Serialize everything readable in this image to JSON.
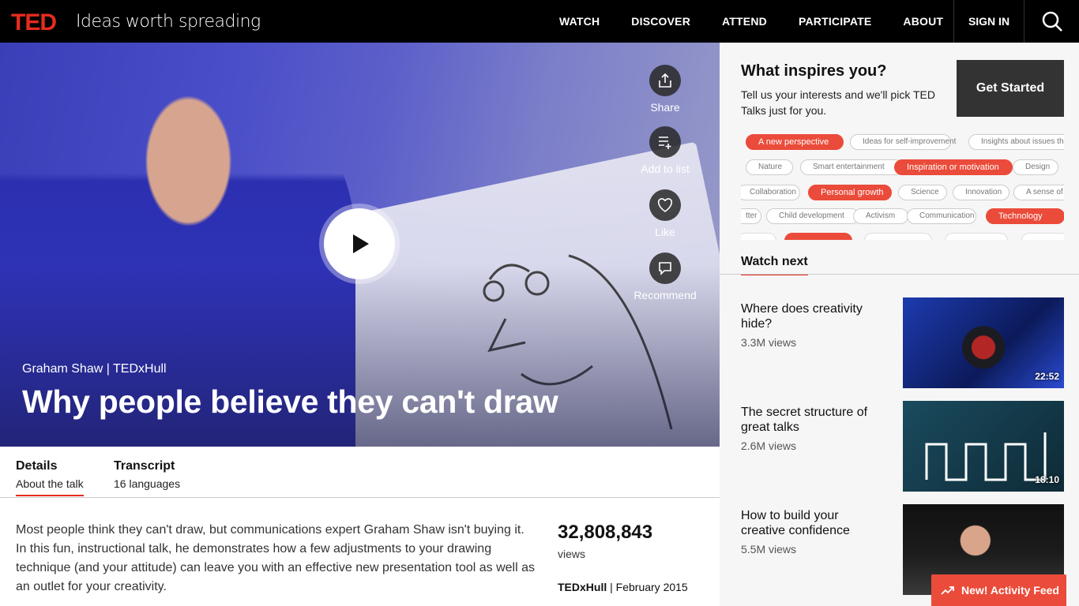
{
  "header": {
    "logo": "TED",
    "tagline": "Ideas worth spreading",
    "nav": [
      "WATCH",
      "DISCOVER",
      "ATTEND",
      "PARTICIPATE",
      "ABOUT"
    ],
    "sign_in": "SIGN IN",
    "search_icon": "search-icon"
  },
  "hero": {
    "speaker": "Graham Shaw | TEDxHull",
    "title": "Why people believe they can't draw",
    "actions": {
      "share": "Share",
      "add_to_list": "Add to list",
      "like": "Like",
      "recommend": "Recommend"
    }
  },
  "tabs": [
    {
      "label": "Details",
      "sub": "About the talk"
    },
    {
      "label": "Transcript",
      "sub": "16 languages"
    }
  ],
  "details": {
    "description": "Most people think they can't draw, but communications expert Graham Shaw isn't buying it. In this fun, instructional talk, he demonstrates how a few adjustments to your drawing technique (and your attitude) can leave you with an effective new presentation tool as well as an outlet for your creativity.",
    "views_count": "32,808,843",
    "views_label": "views",
    "event": "TEDxHull",
    "date": "February 2015"
  },
  "inspire": {
    "title": "What inspires you?",
    "subtitle": "Tell us your interests and we'll pick TED Talks just for you.",
    "cta": "Get Started",
    "rows": [
      [
        {
          "label": "A new perspective",
          "selected": true
        },
        {
          "label": "Ideas for self-improvement",
          "selected": false
        },
        {
          "label": "Insights about issues tha",
          "selected": false
        }
      ],
      [
        {
          "label": "Nature",
          "selected": false
        },
        {
          "label": "Smart entertainment",
          "selected": false
        },
        {
          "label": "Inspiration or motivation",
          "selected": true
        },
        {
          "label": "Design",
          "selected": false
        }
      ],
      [
        {
          "label": "Collaboration",
          "selected": false
        },
        {
          "label": "Personal growth",
          "selected": true
        },
        {
          "label": "Science",
          "selected": false
        },
        {
          "label": "Innovation",
          "selected": false
        },
        {
          "label": "A sense of h",
          "selected": false
        }
      ],
      [
        {
          "label": "tter",
          "selected": false
        },
        {
          "label": "Child development",
          "selected": false
        },
        {
          "label": "Activism",
          "selected": false
        },
        {
          "label": "Communication",
          "selected": false
        },
        {
          "label": "Technology",
          "selected": true
        }
      ]
    ]
  },
  "watch_next": {
    "heading": "Watch next",
    "items": [
      {
        "title": "Where does creativity hide?",
        "views": "3.3M views",
        "duration": "22:52"
      },
      {
        "title": "The secret structure of great talks",
        "views": "2.6M views",
        "duration": "18:10"
      },
      {
        "title": "How to build your creative confidence",
        "views": "5.5M views",
        "duration": ""
      }
    ]
  },
  "activity_feed": "New! Activity Feed",
  "colors": {
    "brand_red": "#e62b1e",
    "chip_red": "#eb4b3a"
  }
}
